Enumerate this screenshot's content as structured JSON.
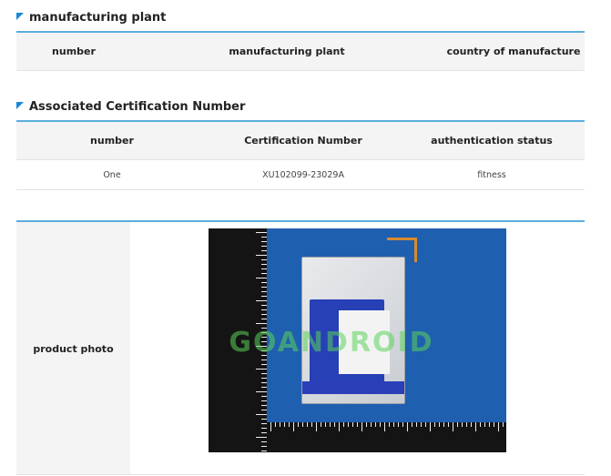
{
  "sections": {
    "plant": {
      "title": "manufacturing plant",
      "headers": [
        "number",
        "manufacturing plant",
        "country of manufacture"
      ]
    },
    "cert": {
      "title": "Associated Certification Number",
      "headers": [
        "number",
        "Certification Number",
        "authentication status"
      ],
      "rows": [
        [
          "One",
          "XU102099-23029A",
          "fitness"
        ]
      ]
    },
    "photo": {
      "label": "product photo",
      "watermark": "GOANDROID"
    }
  },
  "colors": {
    "accent": "#1a88d8",
    "rule": "#5aaedc",
    "header_bg": "#f4f4f4"
  }
}
